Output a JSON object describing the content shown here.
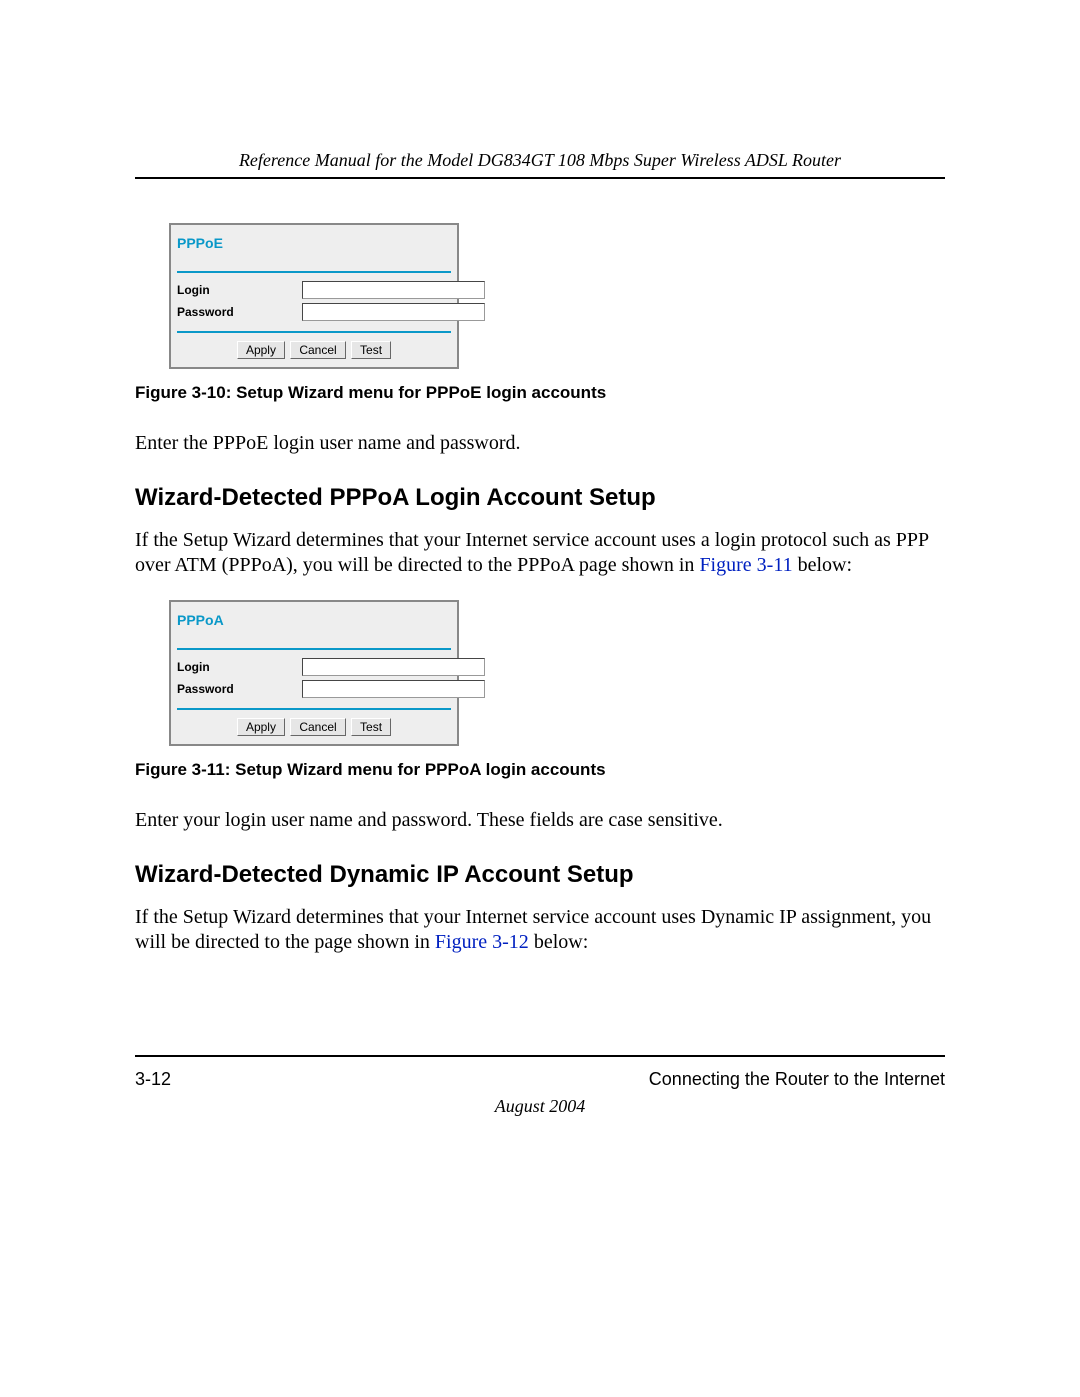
{
  "header": {
    "title": "Reference Manual for the Model DG834GT 108 Mbps Super Wireless ADSL Router"
  },
  "figure10": {
    "panel_title": "PPPoE",
    "login_label": "Login",
    "password_label": "Password",
    "login_value": "",
    "password_value": "",
    "apply_label": "Apply",
    "cancel_label": "Cancel",
    "test_label": "Test",
    "caption": "Figure 3-10:  Setup Wizard menu for PPPoE login accounts"
  },
  "body1": "Enter the PPPoE login user name and password.",
  "heading1": "Wizard-Detected PPPoA Login Account Setup",
  "body2a": "If the Setup Wizard determines that your Internet service account uses a login protocol such as PPP over ATM (PPPoA), you will be directed to the PPPoA page shown in ",
  "body2_link": "Figure 3-11",
  "body2b": " below:",
  "figure11": {
    "panel_title": "PPPoA",
    "login_label": "Login",
    "password_label": "Password",
    "login_value": "",
    "password_value": "",
    "apply_label": "Apply",
    "cancel_label": "Cancel",
    "test_label": "Test",
    "caption": "Figure 3-11:  Setup Wizard menu for PPPoA login accounts"
  },
  "body3": "Enter your login user name and password. These fields are case sensitive.",
  "heading2": "Wizard-Detected Dynamic IP Account Setup",
  "body4a": "If the Setup Wizard determines that your Internet service account uses Dynamic IP assignment, you will be directed to the page shown in ",
  "body4_link": "Figure 3-12",
  "body4b": " below:",
  "footer": {
    "page_number": "3-12",
    "section_title": "Connecting the Router to the Internet",
    "date": "August 2004"
  }
}
